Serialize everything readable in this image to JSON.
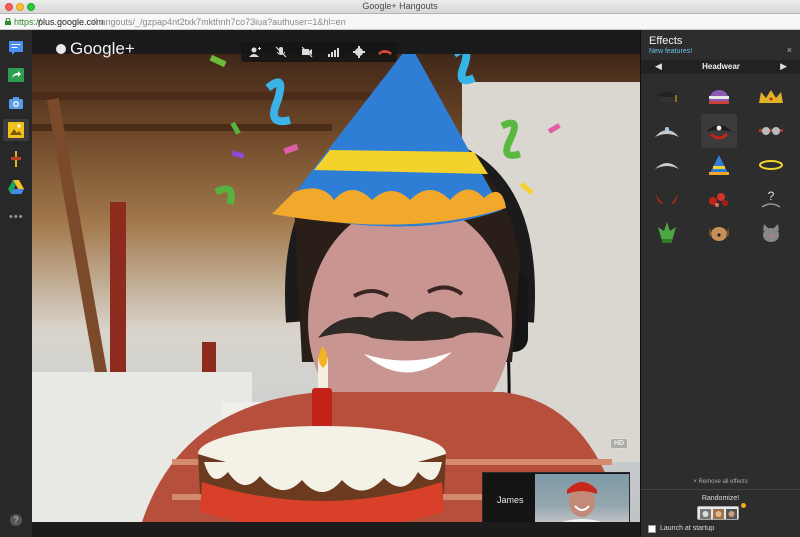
{
  "window": {
    "title": "Google+ Hangouts"
  },
  "address_bar": {
    "scheme": "https://",
    "host": "plus.google.com",
    "path": "/hangouts/_/gzpap4nt2txk7mkthnh7co73iua?authuser=1&hl=en"
  },
  "rail": {
    "items": [
      "chat-icon",
      "share-icon",
      "camera-icon",
      "effects-icon",
      "remote-desktop-icon",
      "drive-icon"
    ],
    "more_label": "•••",
    "help_label": "?"
  },
  "video": {
    "brand": "Google+",
    "hd_label": "HD",
    "controls": [
      "add-people-icon",
      "mute-mic-icon",
      "camera-off-icon",
      "bandwidth-icon",
      "settings-icon",
      "hang-up-icon"
    ],
    "participant_name": "James"
  },
  "effects": {
    "title": "Effects",
    "new_features": "New features!",
    "close": "×",
    "category": "Headwear",
    "prev": "◀",
    "next": "▶",
    "items": [
      "graduation-cap",
      "striped-beanie",
      "gold-crown",
      "silver-tiara",
      "pirate-hat",
      "goggles",
      "headband",
      "party-hat",
      "halo",
      "devil-horns",
      "flower-crown",
      "question-mark",
      "leaf-crown",
      "dog-ears",
      "cat-ears"
    ],
    "question_glyph": "?",
    "remove_all": "× Remove all effects",
    "randomize": "Randomize!",
    "launch_label": "Launch at startup",
    "accent": "#67c1e8"
  }
}
